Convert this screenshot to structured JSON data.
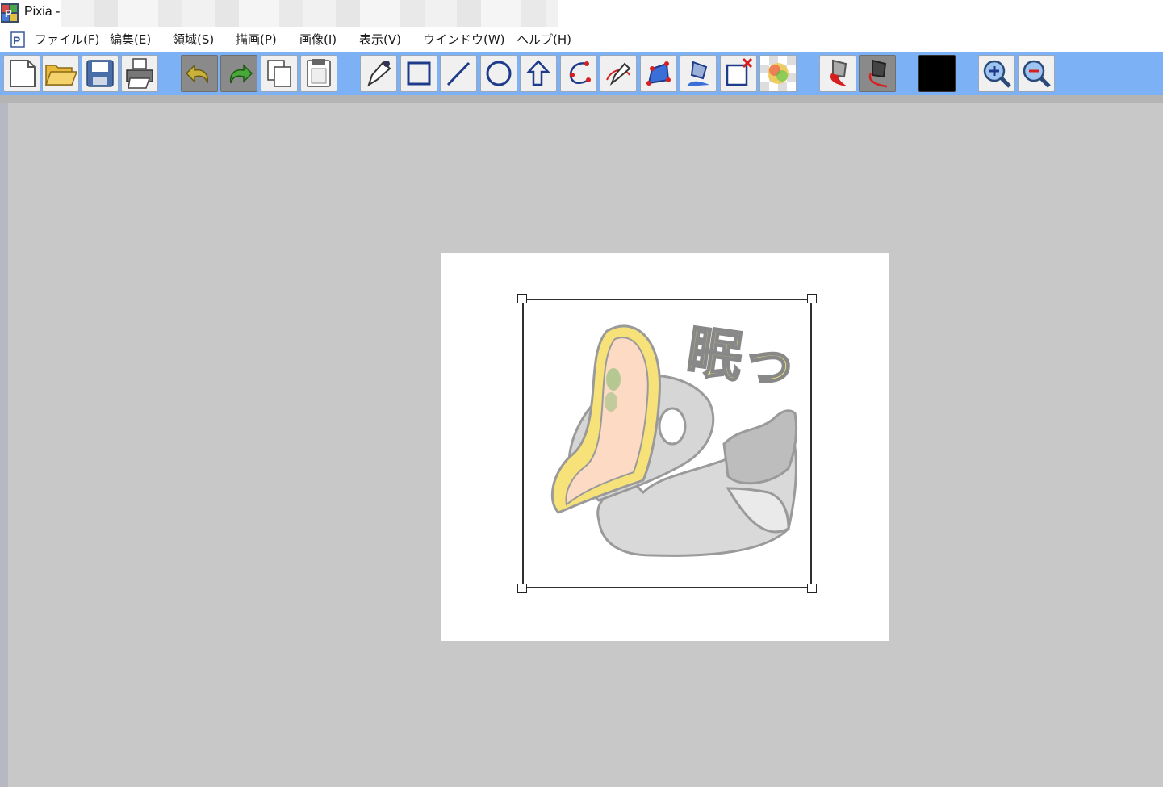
{
  "window": {
    "title": "Pixia -"
  },
  "menu": {
    "items": [
      {
        "label": "ファイル(F)"
      },
      {
        "label": "編集(E)"
      },
      {
        "label": "領域(S)"
      },
      {
        "label": "描画(P)"
      },
      {
        "label": "画像(I)"
      },
      {
        "label": "表示(V)"
      },
      {
        "label": "ウインドウ(W)"
      },
      {
        "label": "ヘルプ(H)"
      }
    ]
  },
  "toolbar": {
    "buttons": [
      {
        "icon": "new-file-icon"
      },
      {
        "icon": "open-folder-icon"
      },
      {
        "icon": "save-icon"
      },
      {
        "icon": "print-icon"
      },
      {
        "icon": "undo-icon"
      },
      {
        "icon": "redo-icon"
      },
      {
        "icon": "copy-icon"
      },
      {
        "icon": "paste-icon"
      },
      {
        "icon": "pen-icon"
      },
      {
        "icon": "rectangle-icon"
      },
      {
        "icon": "line-icon"
      },
      {
        "icon": "circle-icon"
      },
      {
        "icon": "lasso-icon"
      },
      {
        "icon": "curve-select-icon"
      },
      {
        "icon": "pen-select-icon"
      },
      {
        "icon": "polygon-select-icon"
      },
      {
        "icon": "fill-bucket-icon"
      },
      {
        "icon": "clear-selection-icon"
      },
      {
        "icon": "transparency-icon"
      },
      {
        "icon": "bucket-red-icon"
      },
      {
        "icon": "bucket-dark-icon"
      },
      {
        "icon": "color-swatch-icon"
      },
      {
        "icon": "zoom-in-icon"
      },
      {
        "icon": "zoom-out-icon"
      }
    ],
    "current_color": "#000000"
  },
  "canvas": {
    "art_text": "眠っ"
  },
  "colors": {
    "toolbar_bg": "#7cb2f5",
    "workspace_bg": "#c8c8c8",
    "paper": "#ffffff"
  }
}
